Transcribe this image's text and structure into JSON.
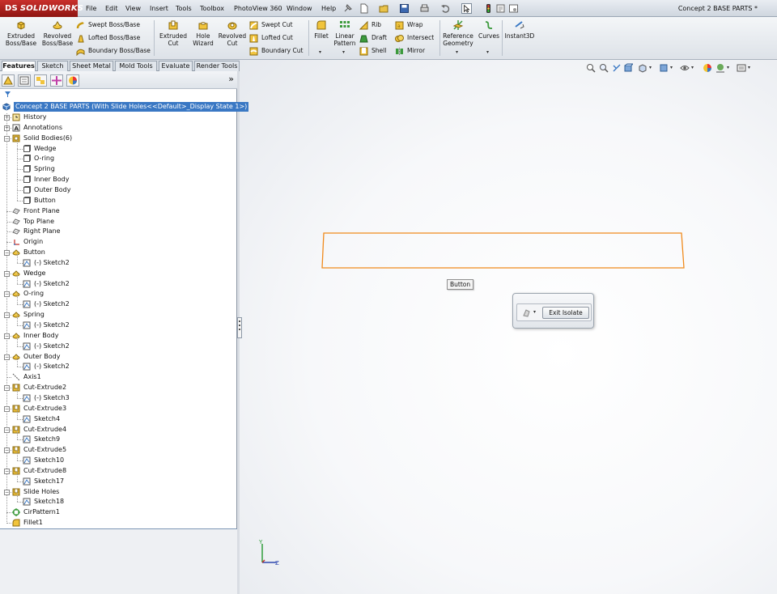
{
  "app": {
    "logo_text": "SOLIDWORKS",
    "logo_prefix": "DS"
  },
  "menu": [
    "File",
    "Edit",
    "View",
    "Insert",
    "Tools",
    "Toolbox",
    "PhotoView 360",
    "Window",
    "Help"
  ],
  "document_title": "Concept 2 BASE PARTS *",
  "command_manager": {
    "extruded_boss": "Extruded\nBoss/Base",
    "revolved_boss": "Revolved\nBoss/Base",
    "swept_boss": "Swept Boss/Base",
    "lofted_boss": "Lofted Boss/Base",
    "boundary_boss": "Boundary Boss/Base",
    "extruded_cut": "Extruded\nCut",
    "hole_wizard": "Hole\nWizard",
    "revolved_cut": "Revolved\nCut",
    "swept_cut": "Swept Cut",
    "lofted_cut": "Lofted Cut",
    "boundary_cut": "Boundary Cut",
    "fillet": "Fillet",
    "linear_pattern": "Linear\nPattern",
    "rib": "Rib",
    "draft": "Draft",
    "shell": "Shell",
    "wrap": "Wrap",
    "intersect": "Intersect",
    "mirror": "Mirror",
    "reference_geometry": "Reference\nGeometry",
    "curves": "Curves",
    "instant3d": "Instant3D"
  },
  "tabs": [
    "Features",
    "Sketch",
    "Sheet Metal",
    "Mold Tools",
    "Evaluate",
    "Render Tools"
  ],
  "active_tab": "Features",
  "panel_toolbar": {
    "expand_glyph": "»"
  },
  "tree": {
    "root": "Concept 2 BASE PARTS  (With Slide Holes<<Default>_Display State 1>)",
    "items": [
      {
        "label": "History",
        "icon": "history-icon"
      },
      {
        "label": "Annotations",
        "icon": "annotations-icon"
      },
      {
        "label": "Solid Bodies(6)",
        "icon": "solid-bodies-icon"
      },
      {
        "label": "Wedge",
        "icon": "body-icon"
      },
      {
        "label": "O-ring",
        "icon": "body-icon"
      },
      {
        "label": "Spring",
        "icon": "body-icon"
      },
      {
        "label": "Inner Body",
        "icon": "body-icon"
      },
      {
        "label": "Outer Body",
        "icon": "body-icon"
      },
      {
        "label": "Button",
        "icon": "body-icon"
      },
      {
        "label": "Front Plane",
        "icon": "plane-icon"
      },
      {
        "label": "Top Plane",
        "icon": "plane-icon"
      },
      {
        "label": "Right Plane",
        "icon": "plane-icon"
      },
      {
        "label": "Origin",
        "icon": "origin-icon"
      },
      {
        "label": "Button",
        "icon": "revolve-feature-icon"
      },
      {
        "label": "(-) Sketch2",
        "icon": "sketch-icon"
      },
      {
        "label": "Wedge",
        "icon": "revolve-feature-icon"
      },
      {
        "label": "(-) Sketch2",
        "icon": "sketch-icon"
      },
      {
        "label": "O-ring",
        "icon": "revolve-feature-icon"
      },
      {
        "label": "(-) Sketch2",
        "icon": "sketch-icon"
      },
      {
        "label": "Spring",
        "icon": "revolve-feature-icon"
      },
      {
        "label": "(-) Sketch2",
        "icon": "sketch-icon"
      },
      {
        "label": "Inner Body",
        "icon": "revolve-feature-icon"
      },
      {
        "label": "(-) Sketch2",
        "icon": "sketch-icon"
      },
      {
        "label": "Outer Body",
        "icon": "revolve-feature-icon"
      },
      {
        "label": "(-) Sketch2",
        "icon": "sketch-icon"
      },
      {
        "label": "Axis1",
        "icon": "axis-icon"
      },
      {
        "label": "Cut-Extrude2",
        "icon": "cut-extrude-icon"
      },
      {
        "label": "(-) Sketch3",
        "icon": "sketch-icon"
      },
      {
        "label": "Cut-Extrude3",
        "icon": "cut-extrude-icon"
      },
      {
        "label": "Sketch4",
        "icon": "sketch-icon"
      },
      {
        "label": "Cut-Extrude4",
        "icon": "cut-extrude-icon"
      },
      {
        "label": "Sketch9",
        "icon": "sketch-icon"
      },
      {
        "label": "Cut-Extrude5",
        "icon": "cut-extrude-icon"
      },
      {
        "label": "Sketch10",
        "icon": "sketch-icon"
      },
      {
        "label": "Cut-Extrude8",
        "icon": "cut-extrude-icon"
      },
      {
        "label": "Sketch17",
        "icon": "sketch-icon"
      },
      {
        "label": "Slide Holes",
        "icon": "cut-extrude-icon"
      },
      {
        "label": "Sketch18",
        "icon": "sketch-icon"
      },
      {
        "label": "CirPattern1",
        "icon": "circular-pattern-icon"
      },
      {
        "label": "Fillet1",
        "icon": "fillet-icon"
      }
    ]
  },
  "viewport": {
    "tooltip": "Button",
    "exit_isolate_label": "Exit Isolate",
    "triad_x": "X",
    "triad_y": "Y",
    "triad_z": "Z"
  },
  "colors": {
    "selection_orange": "#f08a1c",
    "tree_highlight": "#3a78c4",
    "brand_red": "#b0231f"
  }
}
